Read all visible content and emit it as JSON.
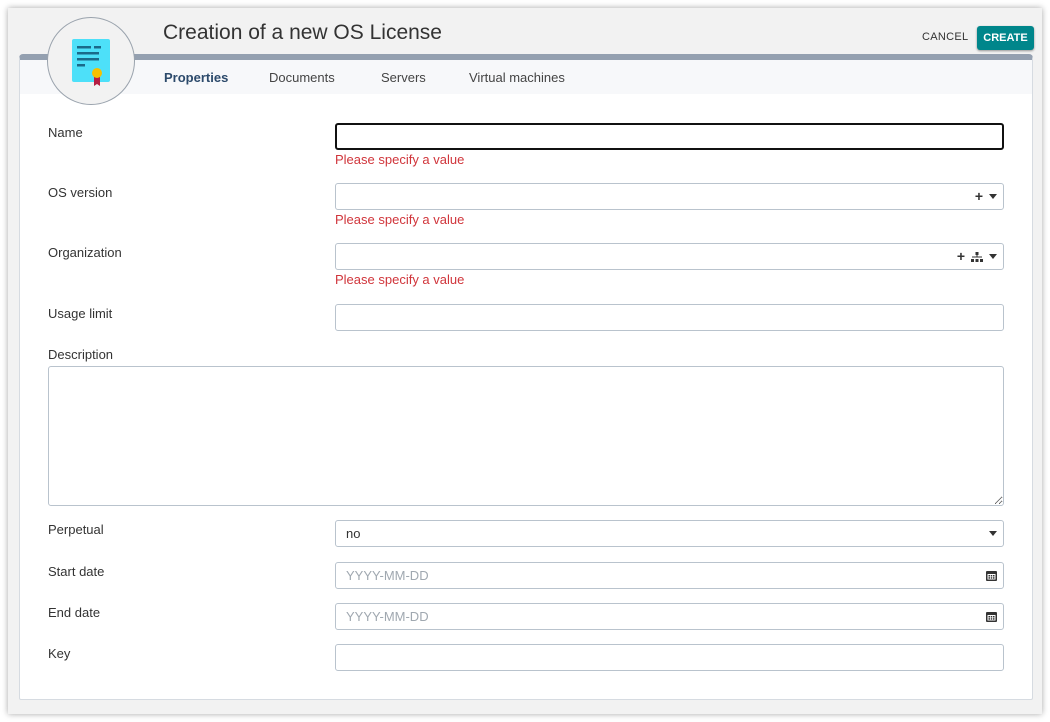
{
  "header": {
    "title": "Creation of a new OS License",
    "cancel_label": "CANCEL",
    "create_label": "CREATE"
  },
  "tabs": [
    {
      "label": "Properties"
    },
    {
      "label": "Documents"
    },
    {
      "label": "Servers"
    },
    {
      "label": "Virtual machines"
    }
  ],
  "form": {
    "name": {
      "label": "Name",
      "value": "",
      "error": "Please specify a value"
    },
    "os_version": {
      "label": "OS version",
      "value": "",
      "error": "Please specify a value"
    },
    "organization": {
      "label": "Organization",
      "value": "",
      "error": "Please specify a value"
    },
    "usage_limit": {
      "label": "Usage limit",
      "value": ""
    },
    "description": {
      "label": "Description",
      "value": ""
    },
    "perpetual": {
      "label": "Perpetual",
      "value": "no"
    },
    "start_date": {
      "label": "Start date",
      "placeholder": "YYYY-MM-DD"
    },
    "end_date": {
      "label": "End date",
      "placeholder": "YYYY-MM-DD"
    },
    "key": {
      "label": "Key",
      "value": ""
    }
  },
  "colors": {
    "accent": "#00868b",
    "error": "#d0353b",
    "header_bar": "#94a0b0"
  }
}
